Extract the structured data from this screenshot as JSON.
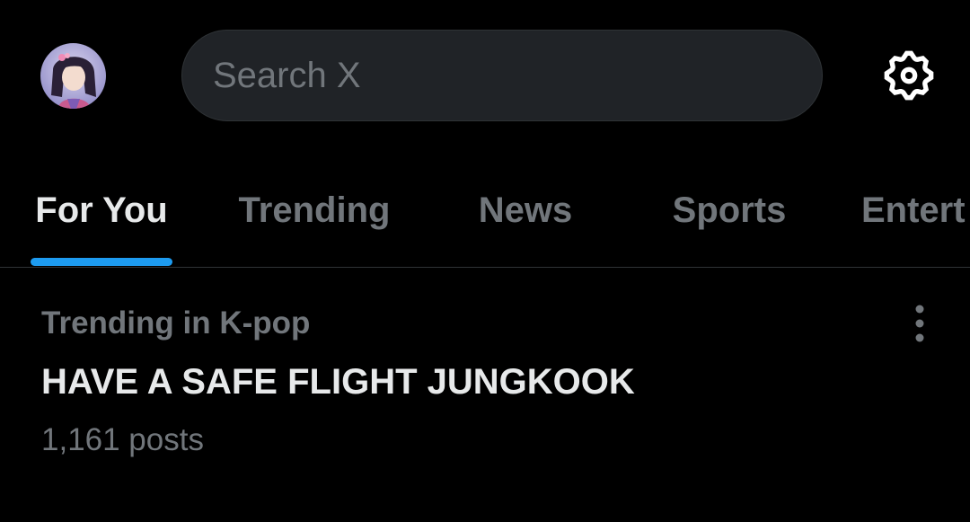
{
  "header": {
    "avatar_icon": "user-avatar",
    "search": {
      "placeholder": "Search X",
      "value": ""
    },
    "settings_icon": "gear-icon"
  },
  "tabs": [
    {
      "label": "For You",
      "active": true
    },
    {
      "label": "Trending",
      "active": false
    },
    {
      "label": "News",
      "active": false
    },
    {
      "label": "Sports",
      "active": false
    },
    {
      "label": "Entert",
      "active": false
    }
  ],
  "trend": {
    "context": "Trending in K-pop",
    "title": "HAVE A SAFE FLIGHT JUNGKOOK",
    "posts": "1,161 posts",
    "more_icon": "more-vertical-icon"
  },
  "colors": {
    "background": "#000000",
    "accent": "#1d9bf0",
    "text_primary": "#e7e9ea",
    "text_secondary": "#71767b",
    "search_bg": "#202327"
  }
}
